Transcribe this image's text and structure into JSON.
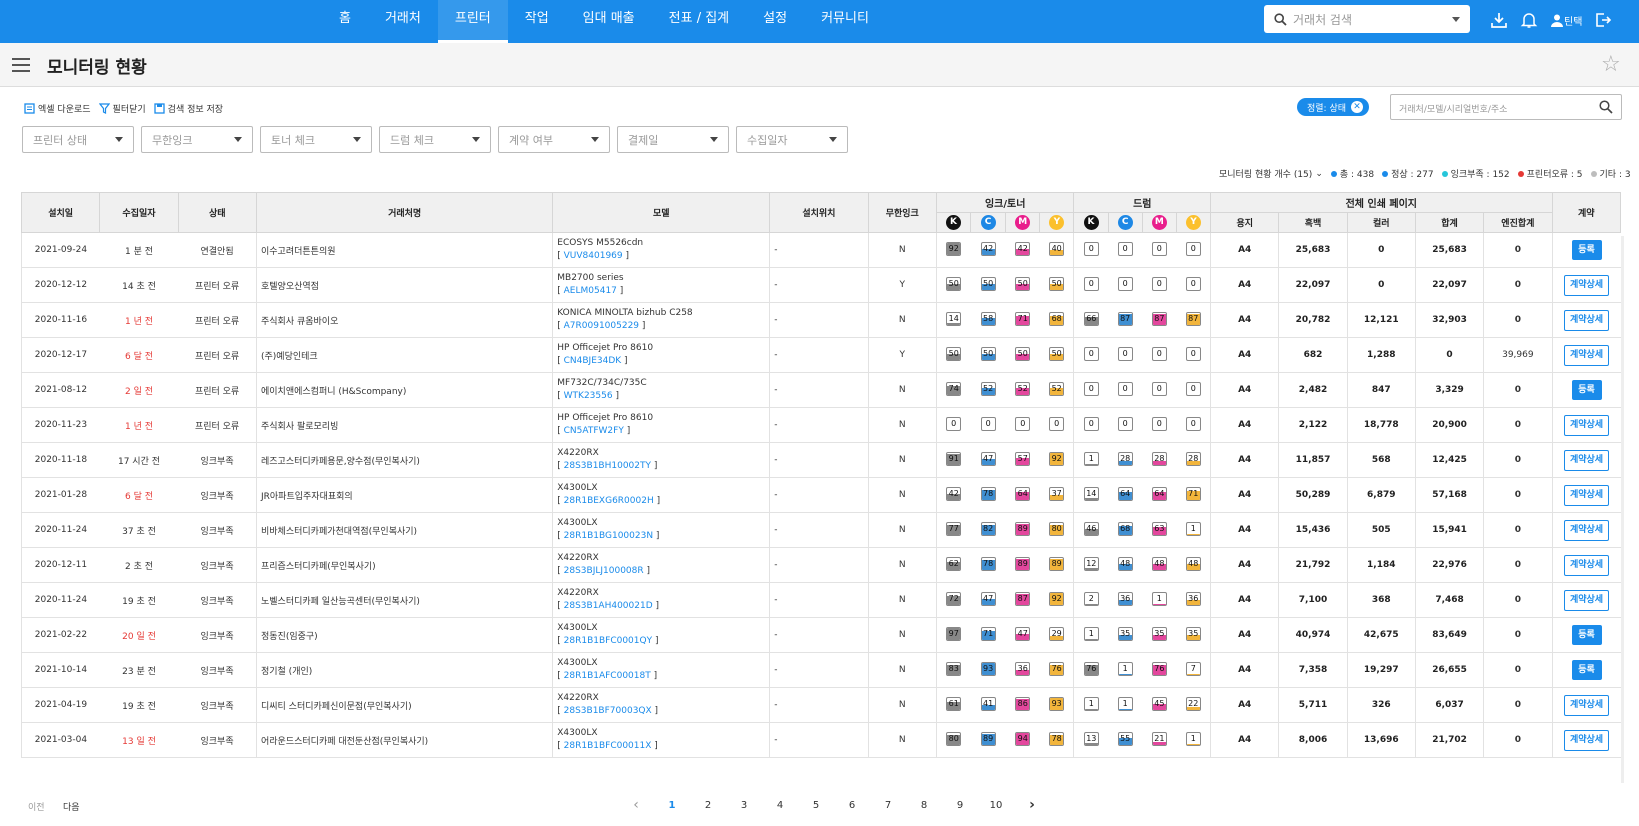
{
  "nav": {
    "items": [
      "홈",
      "거래처",
      "프린터",
      "작업",
      "임대 매출",
      "전표 / 집계",
      "설정",
      "커뮤니티"
    ],
    "active_index": 2,
    "search_placeholder": "거래처 검색",
    "user_label": "틴택"
  },
  "page": {
    "title": "모니터링 현황"
  },
  "toolbar": {
    "excel": "엑셀 다운로드",
    "filter": "필터닫기",
    "save": "검색 정보 저장"
  },
  "sort_chip": "정렬: 상태",
  "search_placeholder": "거래처/모델/시리얼번호/주소",
  "filters": [
    "프린터 상태",
    "무한잉크",
    "토너 체크",
    "드럼 체크",
    "계약 여부",
    "결제일",
    "수집일자"
  ],
  "count": {
    "label": "모니터링 현황 개수 (15)",
    "legend": [
      {
        "text": "총 : 438",
        "color": "#1a8bea"
      },
      {
        "text": "정상 : 277",
        "color": "#1a8bea"
      },
      {
        "text": "잉크부족 : 152",
        "color": "#26c6da"
      },
      {
        "text": "프린터오류 : 5",
        "color": "#e53935"
      },
      {
        "text": "기타 : 3",
        "color": "#bdbdbd"
      }
    ]
  },
  "table": {
    "headers": {
      "install": "설치일",
      "collect": "수집일자",
      "status": "상태",
      "client": "거래처명",
      "model": "모델",
      "location": "설치위치",
      "unlimited": "무한잉크",
      "ink": "잉크/토너",
      "drum": "드럼",
      "pages": "전체 인쇄 페이지",
      "contract": "계약",
      "paper": "용지",
      "mono": "흑백",
      "color": "컬러",
      "total": "합계",
      "engine": "엔진합계"
    },
    "colors": [
      {
        "key": "K",
        "bg": "#111111",
        "fill": "#888888"
      },
      {
        "key": "C",
        "bg": "#1e88e5",
        "fill": "#3f8fd2"
      },
      {
        "key": "M",
        "bg": "#e91e8c",
        "fill": "#e3479d"
      },
      {
        "key": "Y",
        "bg": "#fbc02d",
        "fill": "#f2b53c"
      }
    ],
    "rows": [
      {
        "install": "2021-09-24",
        "collect": "1 분 전",
        "collect_red": false,
        "status": "연결안됨",
        "client": "이수고려더튼튼의원",
        "model": "ECOSYS M5526cdn",
        "serial": "VUV8401969",
        "location": "-",
        "unlimited": "N",
        "ink": [
          92,
          42,
          42,
          40
        ],
        "drum": [
          0,
          0,
          0,
          0
        ],
        "paper": "A4",
        "mono": "25,683",
        "color": "0",
        "total": "25,683",
        "engine": "0",
        "contract": "등록",
        "contract_type": "solid"
      },
      {
        "install": "2020-12-12",
        "collect": "14 초 전",
        "collect_red": false,
        "status": "프린터 오류",
        "client": "호텔양오산역점",
        "model": "MB2700 series",
        "serial": "AELM05417",
        "location": "-",
        "unlimited": "Y",
        "ink": [
          50,
          50,
          50,
          50
        ],
        "drum": [
          0,
          0,
          0,
          0
        ],
        "paper": "A4",
        "mono": "22,097",
        "color": "0",
        "total": "22,097",
        "engine": "0",
        "contract": "계약상세",
        "contract_type": "outline"
      },
      {
        "install": "2020-11-16",
        "collect": "1 년 전",
        "collect_red": true,
        "status": "프린터 오류",
        "client": "주식회사 큐옴바이오",
        "model": "KONICA MINOLTA bizhub C258",
        "serial": "A7R0091005229",
        "location": "-",
        "unlimited": "N",
        "ink": [
          14,
          58,
          71,
          68
        ],
        "drum": [
          66,
          87,
          87,
          87
        ],
        "paper": "A4",
        "mono": "20,782",
        "color": "12,121",
        "total": "32,903",
        "engine": "0",
        "contract": "계약상세",
        "contract_type": "outline"
      },
      {
        "install": "2020-12-17",
        "collect": "6 달 전",
        "collect_red": true,
        "status": "프린터 오류",
        "client": "(주)예당인테크",
        "model": "HP Officejet Pro 8610",
        "serial": "CN4BJE34DK",
        "location": "-",
        "unlimited": "Y",
        "ink": [
          50,
          50,
          50,
          50
        ],
        "drum": [
          0,
          0,
          0,
          0
        ],
        "paper": "A4",
        "mono": "682",
        "color": "1,288",
        "total": "0",
        "engine": "39,969",
        "contract": "계약상세",
        "contract_type": "outline"
      },
      {
        "install": "2021-08-12",
        "collect": "2 일 전",
        "collect_red": true,
        "status": "프린터 오류",
        "client": "에이치앤에스컴퍼니 (H&Scompany)",
        "model": "MF732C/734C/735C",
        "serial": "WTK23556",
        "location": "-",
        "unlimited": "N",
        "ink": [
          74,
          52,
          52,
          52
        ],
        "drum": [
          0,
          0,
          0,
          0
        ],
        "paper": "A4",
        "mono": "2,482",
        "color": "847",
        "total": "3,329",
        "engine": "0",
        "contract": "등록",
        "contract_type": "solid"
      },
      {
        "install": "2020-11-23",
        "collect": "1 년 전",
        "collect_red": true,
        "status": "프린터 오류",
        "client": "주식회사 팔로모리빙",
        "model": "HP Officejet Pro 8610",
        "serial": "CN5ATFW2FY",
        "location": "-",
        "unlimited": "N",
        "ink": [
          0,
          0,
          0,
          0
        ],
        "drum": [
          0,
          0,
          0,
          0
        ],
        "paper": "A4",
        "mono": "2,122",
        "color": "18,778",
        "total": "20,900",
        "engine": "0",
        "contract": "계약상세",
        "contract_type": "outline"
      },
      {
        "install": "2020-11-18",
        "collect": "17 시간 전",
        "collect_red": false,
        "status": "잉크부족",
        "client": "레즈고스터디카페용문,양수점(무인복사기)",
        "model": "X4220RX",
        "serial": "28S3B1BH10002TY",
        "location": "-",
        "unlimited": "N",
        "ink": [
          91,
          47,
          57,
          92
        ],
        "drum": [
          1,
          28,
          28,
          28
        ],
        "paper": "A4",
        "mono": "11,857",
        "color": "568",
        "total": "12,425",
        "engine": "0",
        "contract": "계약상세",
        "contract_type": "outline"
      },
      {
        "install": "2021-01-28",
        "collect": "6 달 전",
        "collect_red": true,
        "status": "잉크부족",
        "client": "JR아파트입주자대표회의",
        "model": "X4300LX",
        "serial": "28R1BEXG6R0002H",
        "location": "-",
        "unlimited": "N",
        "ink": [
          42,
          78,
          64,
          37
        ],
        "drum": [
          14,
          64,
          64,
          71
        ],
        "paper": "A4",
        "mono": "50,289",
        "color": "6,879",
        "total": "57,168",
        "engine": "0",
        "contract": "계약상세",
        "contract_type": "outline"
      },
      {
        "install": "2020-11-24",
        "collect": "37 초 전",
        "collect_red": false,
        "status": "잉크부족",
        "client": "비바체스터디카페가천대역점(무인복사기)",
        "model": "X4300LX",
        "serial": "28R1B1BG100023N",
        "location": "-",
        "unlimited": "N",
        "ink": [
          77,
          82,
          89,
          80
        ],
        "drum": [
          46,
          68,
          63,
          1
        ],
        "paper": "A4",
        "mono": "15,436",
        "color": "505",
        "total": "15,941",
        "engine": "0",
        "contract": "계약상세",
        "contract_type": "outline"
      },
      {
        "install": "2020-12-11",
        "collect": "2 초 전",
        "collect_red": false,
        "status": "잉크부족",
        "client": "프리즘스터디카페(무인복사기)",
        "model": "X4220RX",
        "serial": "28S3BJLJ100008R",
        "location": "-",
        "unlimited": "N",
        "ink": [
          62,
          78,
          89,
          89
        ],
        "drum": [
          12,
          48,
          48,
          48
        ],
        "paper": "A4",
        "mono": "21,792",
        "color": "1,184",
        "total": "22,976",
        "engine": "0",
        "contract": "계약상세",
        "contract_type": "outline"
      },
      {
        "install": "2020-11-24",
        "collect": "19 초 전",
        "collect_red": false,
        "status": "잉크부족",
        "client": "노벨스터디카페 일산능곡센터(무인복사기)",
        "model": "X4220RX",
        "serial": "28S3B1AH400021D",
        "location": "-",
        "unlimited": "N",
        "ink": [
          72,
          47,
          87,
          92
        ],
        "drum": [
          2,
          36,
          1,
          36
        ],
        "paper": "A4",
        "mono": "7,100",
        "color": "368",
        "total": "7,468",
        "engine": "0",
        "contract": "계약상세",
        "contract_type": "outline"
      },
      {
        "install": "2021-02-22",
        "collect": "20 일 전",
        "collect_red": true,
        "status": "잉크부족",
        "client": "정동진(임중구)",
        "model": "X4300LX",
        "serial": "28R1B1BFC0001QY",
        "location": "-",
        "unlimited": "N",
        "ink": [
          97,
          71,
          47,
          29
        ],
        "drum": [
          1,
          35,
          35,
          35
        ],
        "paper": "A4",
        "mono": "40,974",
        "color": "42,675",
        "total": "83,649",
        "engine": "0",
        "contract": "등록",
        "contract_type": "solid"
      },
      {
        "install": "2021-10-14",
        "collect": "23 분 전",
        "collect_red": false,
        "status": "잉크부족",
        "client": "정기철 (개인)",
        "model": "X4300LX",
        "serial": "28R1B1AFC00018T",
        "location": "-",
        "unlimited": "N",
        "ink": [
          83,
          93,
          36,
          76
        ],
        "drum": [
          76,
          1,
          76,
          7
        ],
        "paper": "A4",
        "mono": "7,358",
        "color": "19,297",
        "total": "26,655",
        "engine": "0",
        "contract": "등록",
        "contract_type": "solid"
      },
      {
        "install": "2021-04-19",
        "collect": "19 초 전",
        "collect_red": false,
        "status": "잉크부족",
        "client": "디씨티 스터디카페신이문점(무인복사기)",
        "model": "X4220RX",
        "serial": "28S3B1BF70003QX",
        "location": "-",
        "unlimited": "N",
        "ink": [
          61,
          41,
          86,
          93
        ],
        "drum": [
          1,
          1,
          45,
          22
        ],
        "paper": "A4",
        "mono": "5,711",
        "color": "326",
        "total": "6,037",
        "engine": "0",
        "contract": "계약상세",
        "contract_type": "outline"
      },
      {
        "install": "2021-03-04",
        "collect": "13 일 전",
        "collect_red": true,
        "status": "잉크부족",
        "client": "어라운드스터디카페 대전둔산점(무인복사기)",
        "model": "X4300LX",
        "serial": "28R1B1BFC00011X",
        "location": "-",
        "unlimited": "N",
        "ink": [
          80,
          89,
          94,
          78
        ],
        "drum": [
          13,
          55,
          21,
          1
        ],
        "paper": "A4",
        "mono": "8,006",
        "color": "13,696",
        "total": "21,702",
        "engine": "0",
        "contract": "계약상세",
        "contract_type": "outline"
      }
    ]
  },
  "pager": {
    "prev": "이전",
    "next": "다음",
    "pages": [
      "1",
      "2",
      "3",
      "4",
      "5",
      "6",
      "7",
      "8",
      "9",
      "10"
    ],
    "active": "1"
  }
}
